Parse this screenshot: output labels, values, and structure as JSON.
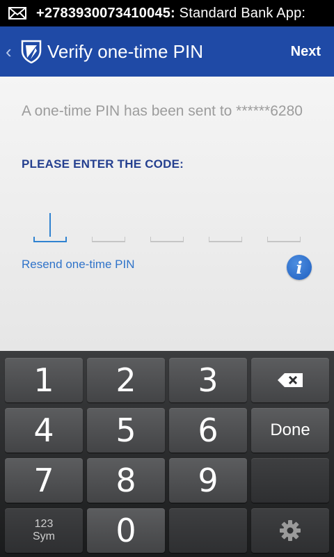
{
  "status_bar": {
    "sender": "+2783930073410045:",
    "message_preview": " Standard Bank App:",
    "notification_icon": "mail-icon"
  },
  "app_bar": {
    "title": "Verify one-time PIN",
    "next_label": "Next",
    "back_icon": "chevron-left-icon",
    "logo_icon": "standard-bank-shield-icon",
    "color": "#1f4aa6"
  },
  "content": {
    "message": "A one-time PIN has been sent to ******6280",
    "prompt": "PLEASE ENTER THE CODE:",
    "pin_values": [
      "",
      "",
      "",
      "",
      ""
    ],
    "resend_label": "Resend one-time PIN",
    "info_label": "i",
    "accent_color": "#2f82d0"
  },
  "keyboard": {
    "keys": [
      "1",
      "2",
      "3",
      "4",
      "5",
      "6",
      "7",
      "8",
      "9",
      "0"
    ],
    "done_label": "Done",
    "sym_label_top": "123",
    "sym_label_bottom": "Sym",
    "backspace_icon": "backspace-icon",
    "settings_icon": "gear-icon"
  }
}
